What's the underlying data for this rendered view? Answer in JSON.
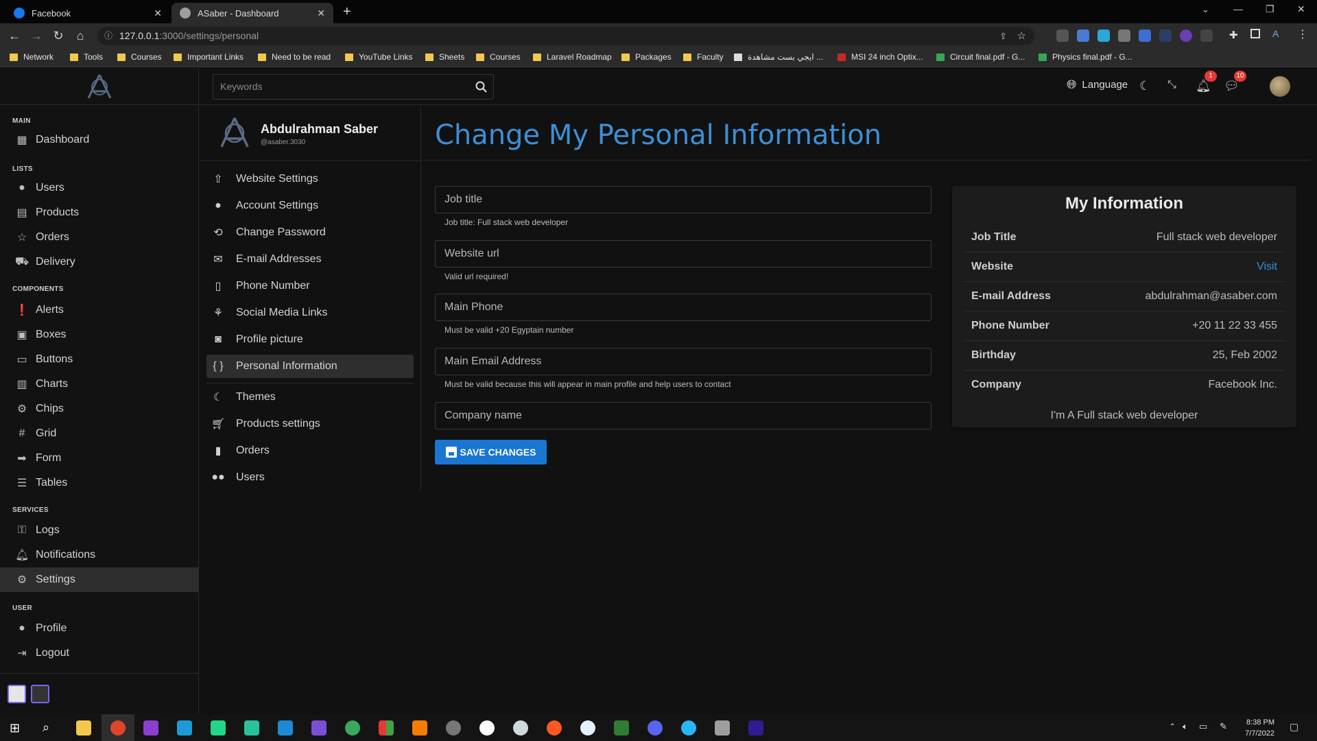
{
  "browser": {
    "tabs": [
      {
        "title": "Facebook",
        "icon_color": "#1877f2"
      },
      {
        "title": "ASaber - Dashboard",
        "icon_color": "#9e9e9e"
      }
    ],
    "url_host": "127.0.0.1",
    "url_rest": ":3000/settings/personal",
    "bookmarks": [
      "Network",
      "Tools",
      "Courses",
      "Important Links",
      "Need to be read",
      "YouTube Links",
      "Sheets",
      "Courses",
      "Laravel Roadmap",
      "Packages",
      "Faculty",
      "ايجي بست مشاهدة ...",
      "MSI 24 inch Optix...",
      "Circuit final.pdf - G...",
      "Physics final.pdf - G..."
    ]
  },
  "header": {
    "search_placeholder": "Keywords",
    "language_label": "Language",
    "notifications_count": "1",
    "messages_count": "10"
  },
  "sidebar": {
    "sections": {
      "main": "MAIN",
      "lists": "LISTS",
      "components": "COMPONENTS",
      "services": "SERVICES",
      "user": "USER"
    },
    "items": {
      "dashboard": "Dashboard",
      "users": "Users",
      "products": "Products",
      "orders": "Orders",
      "delivery": "Delivery",
      "alerts": "Alerts",
      "boxes": "Boxes",
      "buttons": "Buttons",
      "charts": "Charts",
      "chips": "Chips",
      "grid": "Grid",
      "form": "Form",
      "tables": "Tables",
      "logs": "Logs",
      "notifications": "Notifications",
      "settings": "Settings",
      "profile": "Profile",
      "logout": "Logout"
    }
  },
  "settings_menu": {
    "user_name": "Abdulrahman Saber",
    "user_handle": "@asaber.3030",
    "items": {
      "website_settings": "Website Settings",
      "account_settings": "Account Settings",
      "change_password": "Change Password",
      "email_addresses": "E-mail Addresses",
      "phone_number": "Phone Number",
      "social_media_links": "Social Media Links",
      "profile_picture": "Profile picture",
      "personal_information": "Personal Information",
      "themes": "Themes",
      "products_settings": "Products settings",
      "orders": "Orders",
      "users": "Users"
    }
  },
  "main": {
    "title": "Change My Personal Information",
    "fields": {
      "job_title": {
        "placeholder": "Job title",
        "hint": "Job title: Full stack web developer"
      },
      "website_url": {
        "placeholder": "Website url",
        "hint": "Valid url required!"
      },
      "main_phone": {
        "placeholder": "Main Phone",
        "hint": "Must be valid +20 Egyptain number"
      },
      "main_email": {
        "placeholder": "Main Email Address",
        "hint": "Must be valid because this will appear in main profile and help users to contact"
      },
      "company_name": {
        "placeholder": "Company name"
      }
    },
    "save_label": "SAVE CHANGES"
  },
  "info_card": {
    "title": "My Information",
    "rows": [
      {
        "key": "Job Title",
        "value": "Full stack web developer"
      },
      {
        "key": "Website",
        "value": "Visit"
      },
      {
        "key": "E-mail Address",
        "value": "abdulrahman@asaber.com"
      },
      {
        "key": "Phone Number",
        "value": "+20 11 22 33 455"
      },
      {
        "key": "Birthday",
        "value": "25, Feb 2002"
      },
      {
        "key": "Company",
        "value": "Facebook Inc."
      }
    ],
    "footer": "I'm A Full stack web developer"
  },
  "taskbar": {
    "time": "8:38 PM",
    "date": "7/7/2022"
  },
  "colors": {
    "accent": "#3d8fd6",
    "button": "#1976d2",
    "badge": "#e53935"
  }
}
